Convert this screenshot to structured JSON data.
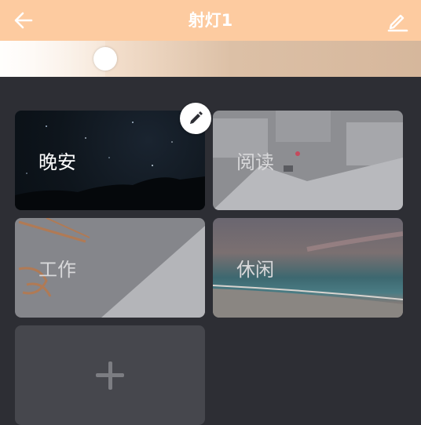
{
  "header": {
    "title": "射灯1",
    "back_icon": "back-arrow-icon",
    "edit_icon": "edit-pencil-icon",
    "bg_color": "#fdcba0"
  },
  "brightness": {
    "value": 0.25
  },
  "scenes": [
    {
      "label": "晚安"
    },
    {
      "label": "阅读"
    },
    {
      "label": "工作"
    },
    {
      "label": "休闲"
    }
  ],
  "add_scene": {
    "icon": "plus-icon"
  },
  "edit_scene": {
    "icon": "pencil-icon"
  }
}
